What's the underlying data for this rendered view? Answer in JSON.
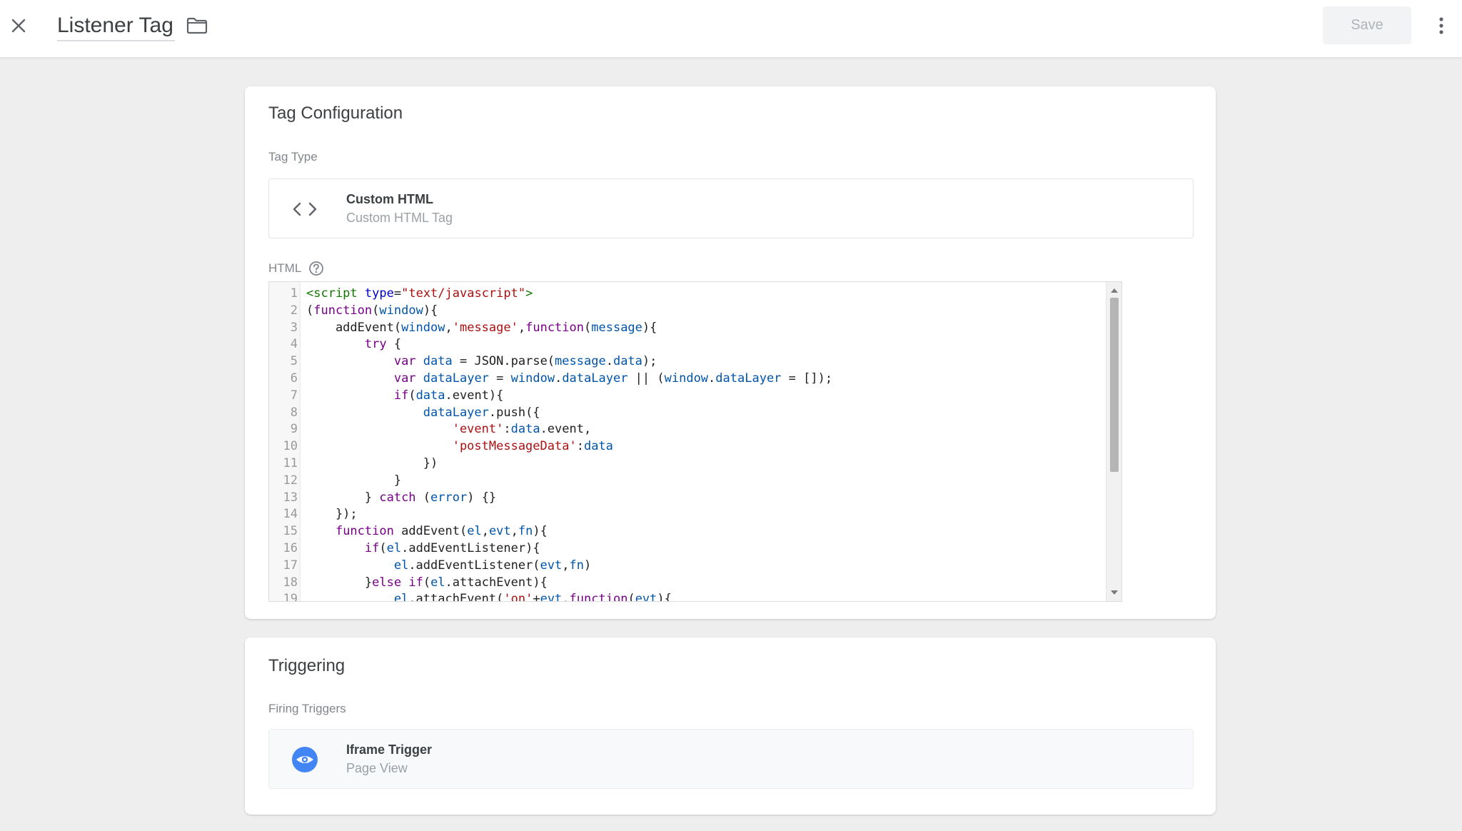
{
  "header": {
    "title": "Listener Tag",
    "save_label": "Save",
    "icons": {
      "close": "close-icon",
      "folder": "folder-icon",
      "more": "more-vert-icon"
    }
  },
  "tag_configuration": {
    "title": "Tag Configuration",
    "tag_type_label": "Tag Type",
    "tag_type": {
      "name": "Custom HTML",
      "subtitle": "Custom HTML Tag",
      "icon": "code-brackets-icon"
    },
    "html_label": "HTML",
    "help_icon": "help-circle-icon",
    "code_lines": [
      {
        "n": "1",
        "text": "<script type=\"text/javascript\">"
      },
      {
        "n": "2",
        "text": "(function(window){"
      },
      {
        "n": "3",
        "text": "    addEvent(window,'message',function(message){"
      },
      {
        "n": "4",
        "text": "        try {"
      },
      {
        "n": "5",
        "text": "            var data = JSON.parse(message.data);"
      },
      {
        "n": "6",
        "text": "            var dataLayer = window.dataLayer || (window.dataLayer = []);"
      },
      {
        "n": "7",
        "text": "            if(data.event){"
      },
      {
        "n": "8",
        "text": "                dataLayer.push({"
      },
      {
        "n": "9",
        "text": "                    'event':data.event,"
      },
      {
        "n": "10",
        "text": "                    'postMessageData':data"
      },
      {
        "n": "11",
        "text": "                })"
      },
      {
        "n": "12",
        "text": "            }"
      },
      {
        "n": "13",
        "text": "        } catch (error) {}"
      },
      {
        "n": "14",
        "text": "    });"
      },
      {
        "n": "15",
        "text": "    function addEvent(el,evt,fn){"
      },
      {
        "n": "16",
        "text": "        if(el.addEventListener){"
      },
      {
        "n": "17",
        "text": "            el.addEventListener(evt,fn)"
      },
      {
        "n": "18",
        "text": "        }else if(el.attachEvent){"
      },
      {
        "n": "19",
        "text": "            el.attachEvent('on'+evt,function(evt){"
      }
    ]
  },
  "triggering": {
    "title": "Triggering",
    "firing_label": "Firing Triggers",
    "trigger": {
      "name": "Iframe Trigger",
      "subtitle": "Page View",
      "icon": "eye-icon",
      "icon_color": "#4285f4"
    }
  },
  "colors": {
    "syntax_tag": "#117700",
    "syntax_attr": "#0000cc",
    "syntax_string": "#aa1111",
    "syntax_keyword": "#770088",
    "syntax_variable": "#0055aa"
  }
}
